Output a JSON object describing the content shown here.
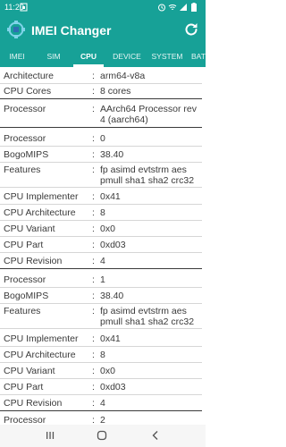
{
  "status_bar": {
    "time": "11:20"
  },
  "app": {
    "title": "IMEI Changer"
  },
  "tabs": [
    {
      "label": "IMEI"
    },
    {
      "label": "SIM"
    },
    {
      "label": "CPU"
    },
    {
      "label": "DEVICE"
    },
    {
      "label": "SYSTEM"
    },
    {
      "label": "BAT"
    }
  ],
  "rows": [
    {
      "label": "Architecture",
      "value": "arm64-v8a"
    },
    {
      "label": "CPU Cores",
      "value": "8 cores"
    },
    {
      "label": "Processor",
      "value": "AArch64 Processor rev 4 (aarch64)"
    },
    {
      "label": "Processor",
      "value": "0"
    },
    {
      "label": "BogoMIPS",
      "value": "38.40"
    },
    {
      "label": "Features",
      "value": "fp asimd evtstrm aes pmull sha1 sha2 crc32"
    },
    {
      "label": "CPU Implementer",
      "value": "0x41"
    },
    {
      "label": "CPU Architecture",
      "value": "8"
    },
    {
      "label": "CPU Variant",
      "value": "0x0"
    },
    {
      "label": "CPU Part",
      "value": "0xd03"
    },
    {
      "label": "CPU Revision",
      "value": "4"
    },
    {
      "label": "Processor",
      "value": "1"
    },
    {
      "label": "BogoMIPS",
      "value": "38.40"
    },
    {
      "label": "Features",
      "value": "fp asimd evtstrm aes pmull sha1 sha2 crc32"
    },
    {
      "label": "CPU Implementer",
      "value": "0x41"
    },
    {
      "label": "CPU Architecture",
      "value": "8"
    },
    {
      "label": "CPU Variant",
      "value": "0x0"
    },
    {
      "label": "CPU Part",
      "value": "0xd03"
    },
    {
      "label": "CPU Revision",
      "value": "4"
    },
    {
      "label": "Processor",
      "value": "2"
    }
  ],
  "colon": ":",
  "icons": {
    "app_logo": "app-logo-icon",
    "refresh": "refresh-icon",
    "nav_recents": "recents-icon",
    "nav_home": "home-icon",
    "nav_back": "back-icon"
  },
  "colors": {
    "accent": "#17a197",
    "text": "#3a3a3a",
    "nav_bg": "#f6f6f6"
  }
}
